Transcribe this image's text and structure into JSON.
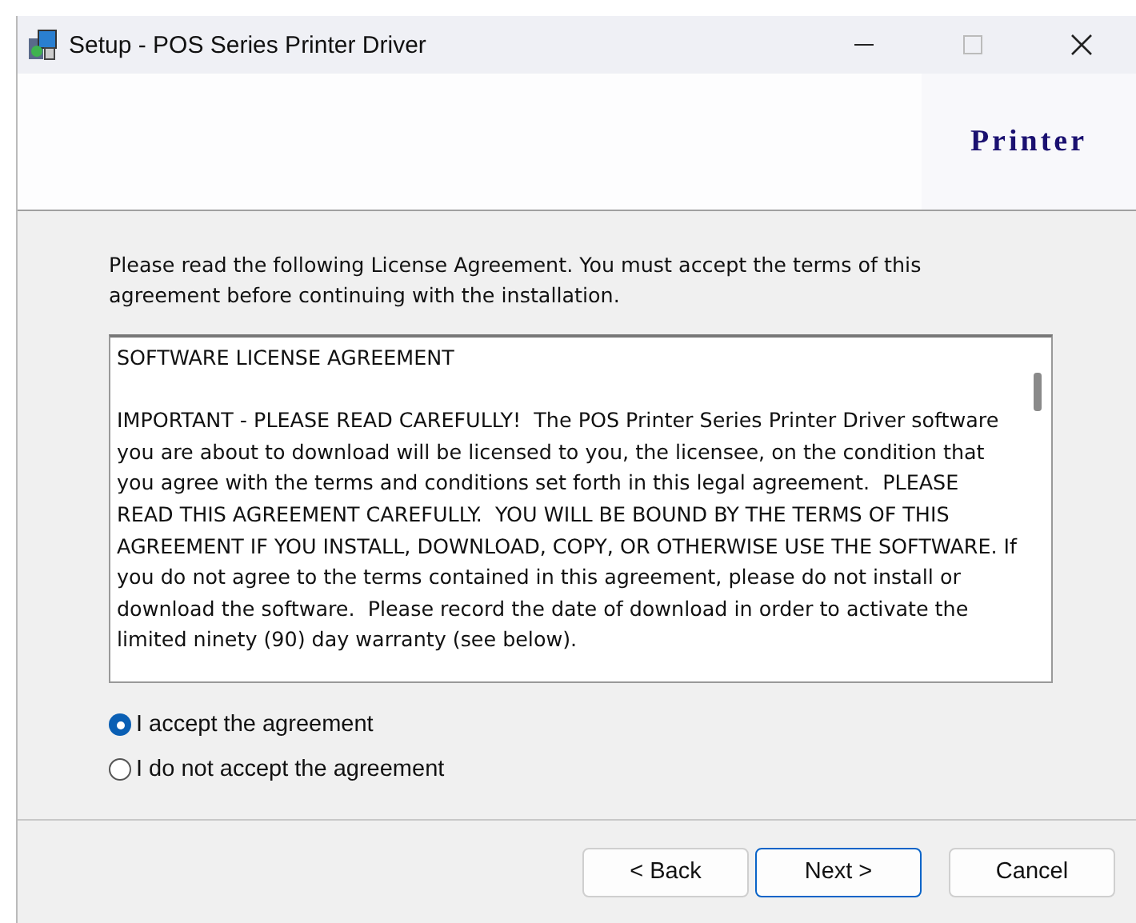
{
  "window": {
    "title": "Setup - POS Series Printer Driver"
  },
  "banner": {
    "logo": "Printer"
  },
  "intro": "Please read the following License Agreement. You must accept the terms of this agreement before continuing with the installation.",
  "license": {
    "paragraphs": [
      "SOFTWARE LICENSE AGREEMENT",
      "IMPORTANT - PLEASE READ CAREFULLY!  The POS Printer Series Printer Driver software you are about to download will be licensed to you, the licensee, on the condition that you agree with the terms and conditions set forth in this legal agreement.  PLEASE READ THIS AGREEMENT CAREFULLY.  YOU WILL BE BOUND BY THE TERMS OF THIS AGREEMENT IF YOU INSTALL, DOWNLOAD, COPY, OR OTHERWISE USE THE SOFTWARE. If you do not agree to the terms contained in this agreement, please do not install or download the software.  Please record the date of download in order to activate the limited ninety (90) day warranty (see below)."
    ]
  },
  "options": [
    {
      "label": "I accept the agreement",
      "selected": true
    },
    {
      "label": "I do not accept the agreement",
      "selected": false
    }
  ],
  "buttons": [
    {
      "label": "< Back",
      "default": false
    },
    {
      "label": "Next >",
      "default": true
    },
    {
      "label": "Cancel",
      "default": false
    }
  ]
}
